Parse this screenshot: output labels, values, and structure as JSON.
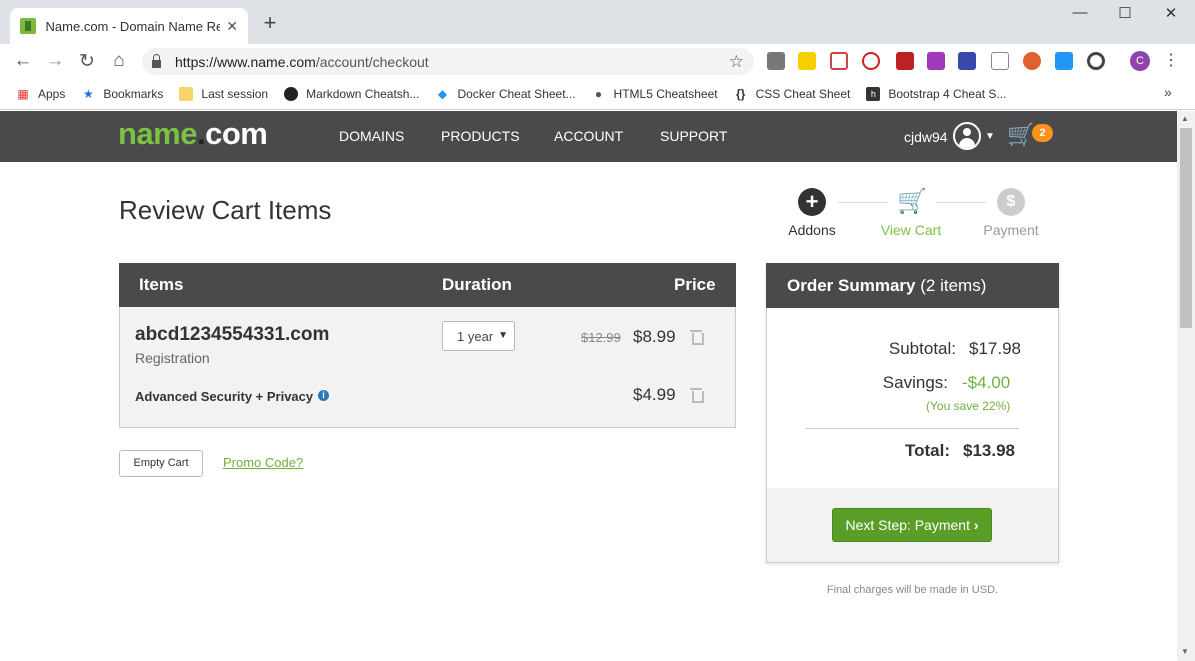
{
  "browser": {
    "tab_title": "Name.com - Domain Name Regis",
    "url_host": "https://www.name.com",
    "url_path": "/account/checkout",
    "bookmarks": [
      "Apps",
      "Bookmarks",
      "Last session",
      "Markdown Cheatsh...",
      "Docker Cheat Sheet...",
      "HTML5 Cheatsheet",
      "CSS Cheat Sheet",
      "Bootstrap 4 Cheat S..."
    ],
    "profile_initial": "C"
  },
  "site": {
    "logo_left": "name",
    "logo_dot": ".",
    "logo_right": "com",
    "menu": [
      "DOMAINS",
      "PRODUCTS",
      "ACCOUNT",
      "SUPPORT"
    ],
    "username": "cjdw94",
    "cart_count": "2"
  },
  "page": {
    "title": "Review Cart Items",
    "steps": [
      "Addons",
      "View Cart",
      "Payment"
    ],
    "active_step": "View Cart"
  },
  "cart": {
    "headers": {
      "items": "Items",
      "duration": "Duration",
      "price": "Price"
    },
    "domain": "abcd1234554331.com",
    "domain_type": "Registration",
    "duration": "1 year",
    "old_price": "$12.99",
    "price": "$8.99",
    "addon_name": "Advanced Security + Privacy",
    "addon_price": "$4.99",
    "empty_label": "Empty Cart",
    "promo_label": "Promo Code?"
  },
  "summary": {
    "title": "Order Summary",
    "count": "(2 items)",
    "subtotal_label": "Subtotal:",
    "subtotal": "$17.98",
    "savings_label": "Savings:",
    "savings": "-$4.00",
    "save_pct": "(You save 22%)",
    "total_label": "Total:",
    "total": "$13.98",
    "next_label": "Next Step: Payment",
    "note": "Final charges will be made in USD."
  },
  "colors": {
    "brand_green": "#7cc242",
    "nav_bg": "#4a4a4c",
    "button_green": "#5a9e27",
    "badge_orange": "#f7931e"
  }
}
